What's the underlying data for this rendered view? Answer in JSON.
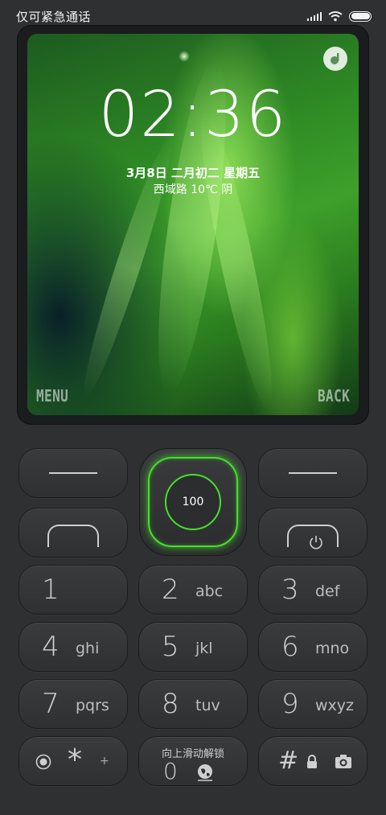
{
  "status_bar": {
    "carrier_text": "仅可紧急通话",
    "battery_level": 1.0
  },
  "lock_screen": {
    "time": "02:36",
    "date": "3月8日 二月初二  星期五",
    "weather": "西域路  10℃  阴",
    "softkey_left": "MENU",
    "softkey_right": "BACK",
    "music_icon": "music-note-icon"
  },
  "keypad": {
    "center_value": "100",
    "keys": [
      {
        "num": "1",
        "letters": ""
      },
      {
        "num": "2",
        "letters": "abc"
      },
      {
        "num": "3",
        "letters": "def"
      },
      {
        "num": "4",
        "letters": "ghi"
      },
      {
        "num": "5",
        "letters": "jkl"
      },
      {
        "num": "6",
        "letters": "mno"
      },
      {
        "num": "7",
        "letters": "pqrs"
      },
      {
        "num": "8",
        "letters": "tuv"
      },
      {
        "num": "9",
        "letters": "wxyz"
      }
    ],
    "star_label": "*",
    "star_sub": "+",
    "zero_num": "0",
    "unlock_hint": "向上滑动解锁",
    "hash_label": "#"
  },
  "colors": {
    "accent_green": "#46e02a",
    "body_bg": "#2f3032"
  }
}
